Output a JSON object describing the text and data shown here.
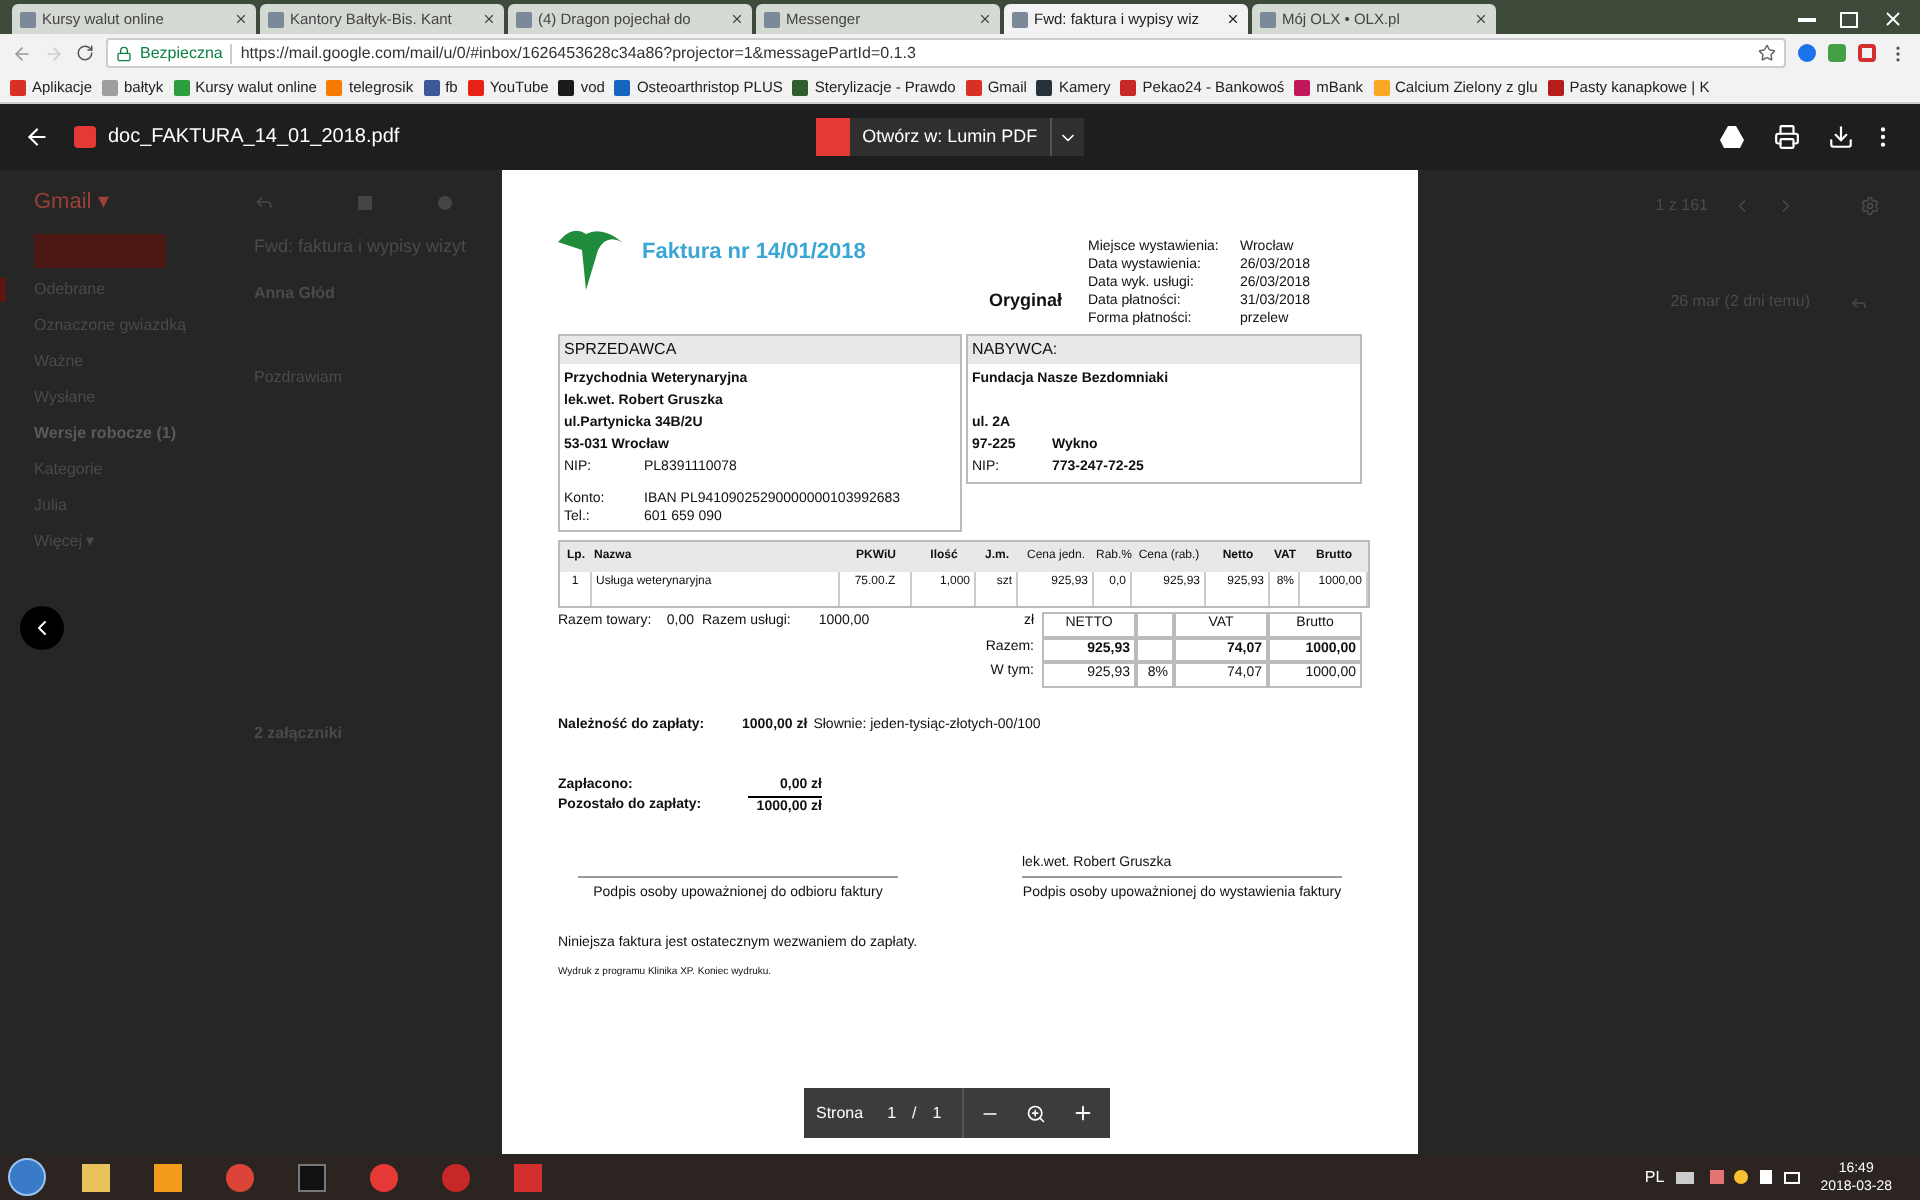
{
  "browser": {
    "tabs": [
      {
        "title": "Kursy walut online",
        "selected": false
      },
      {
        "title": "Kantory Bałtyk-Bis. Kant",
        "selected": false
      },
      {
        "title": "(4) Dragon pojechał do",
        "selected": false
      },
      {
        "title": "Messenger",
        "selected": false
      },
      {
        "title": "Fwd: faktura i wypisy wiz",
        "selected": true
      },
      {
        "title": "Mój OLX • OLX.pl",
        "selected": false
      }
    ],
    "address": {
      "secure_label": "Bezpieczna",
      "url": "https://mail.google.com/mail/u/0/#inbox/1626453628c34a86?projector=1&messagePartId=0.1.3"
    },
    "bookmarks": [
      {
        "label": "Aplikacje",
        "color": "#d93025"
      },
      {
        "label": "bałtyk",
        "color": "#9e9e9e"
      },
      {
        "label": "Kursy walut online",
        "color": "#2e9e3e"
      },
      {
        "label": "telegrosik",
        "color": "#f57c00"
      },
      {
        "label": "fb",
        "color": "#3b5998"
      },
      {
        "label": "YouTube",
        "color": "#e62117"
      },
      {
        "label": "vod",
        "color": "#1b1b1b"
      },
      {
        "label": "Osteoarthristop PLUS",
        "color": "#1565c0"
      },
      {
        "label": "Sterylizacje - Prawdo",
        "color": "#2e5d2e"
      },
      {
        "label": "Gmail",
        "color": "#d93025"
      },
      {
        "label": "Kamery",
        "color": "#263238"
      },
      {
        "label": "Pekao24 - Bankowoś",
        "color": "#c62828"
      },
      {
        "label": "mBank",
        "color": "#c2185b"
      },
      {
        "label": "Calcium Zielony z glu",
        "color": "#f9a825"
      },
      {
        "label": "Pasty kanapkowe | K",
        "color": "#b71c1c"
      }
    ]
  },
  "viewer": {
    "filename": "doc_FAKTURA_14_01_2018.pdf",
    "open_with": "Otwórz w: Lumin PDF"
  },
  "gmail": {
    "logo": "Gmail ▾",
    "nav": [
      {
        "label": "Odebrane",
        "selected": true
      },
      {
        "label": "Oznaczone gwiazdką",
        "selected": false
      },
      {
        "label": "Ważne",
        "selected": false
      },
      {
        "label": "Wysłane",
        "selected": false
      },
      {
        "label": "Wersje robocze (1)",
        "selected": false
      },
      {
        "label": "Kategorie",
        "selected": false
      },
      {
        "label": "Julia",
        "selected": false
      },
      {
        "label": "Więcej ▾",
        "selected": false
      }
    ],
    "subject": "Fwd: faktura i wypisy wizyt",
    "sender": "Anna Głód",
    "greeting": "Pozdrawiam",
    "attachments": "2 załączniki",
    "counter": "1 z 161",
    "date": "26 mar (2 dni temu)"
  },
  "invoice": {
    "title": "Faktura nr 14/01/2018",
    "copy": "Oryginał",
    "meta": [
      [
        "Miejsce wystawienia:",
        "Wrocław"
      ],
      [
        "Data wystawienia:",
        "26/03/2018"
      ],
      [
        "Data wyk. usługi:",
        "26/03/2018"
      ],
      [
        "Data płatności:",
        "31/03/2018"
      ],
      [
        "Forma płatności:",
        "przelew"
      ]
    ],
    "seller": {
      "header": "SPRZEDAWCA",
      "lines": [
        "Przychodnia Weterynaryjna",
        "lek.wet. Robert Gruszka",
        "ul.Partynicka 34B/2U",
        "53-031 Wrocław"
      ],
      "fields": [
        [
          "NIP:",
          "PL8391110078"
        ],
        [
          "Konto:",
          "IBAN PL94109025290000000103992683"
        ],
        [
          "Tel.:",
          "601 659 090"
        ]
      ]
    },
    "buyer": {
      "header": "NABYWCA:",
      "name": "Fundacja Nasze Bezdomniaki",
      "street": "ul. 2A",
      "postcode": "97-225",
      "city": "Wykno",
      "nip_label": "NIP:",
      "nip": "773-247-72-25"
    },
    "columns": [
      "Lp.",
      "Nazwa",
      "PKWiU",
      "Ilość",
      "J.m.",
      "Cena jedn.",
      "Rab.%",
      "Cena (rab.)",
      "Netto",
      "VAT",
      "Brutto"
    ],
    "rows": [
      [
        "1",
        "Usługa weterynaryjna",
        "75.00.Z",
        "1,000",
        "szt",
        "925,93",
        "0,0",
        "925,93",
        "925,93",
        "8%",
        "1000,00"
      ]
    ],
    "subtotals": [
      [
        "Razem towary:",
        "0,00"
      ],
      [
        "Razem usługi:",
        "1000,00"
      ]
    ],
    "currency": "zł",
    "summary_header": [
      "NETTO",
      "VAT",
      "Brutto"
    ],
    "summary_rows": [
      {
        "label": "Razem:",
        "cells": [
          "925,93",
          "",
          "74,07",
          "1000,00"
        ],
        "bold": true
      },
      {
        "label": "W tym:",
        "cells": [
          "925,93",
          "8%",
          "74,07",
          "1000,00"
        ],
        "bold": false
      }
    ],
    "due": {
      "label": "Należność do zapłaty:",
      "amount": "1000,00 zł",
      "words": "Słownie: jeden-tysiąc-złotych-00/100"
    },
    "paid": [
      [
        "Zapłacono:",
        "0,00 zł"
      ],
      [
        "Pozostało do zapłaty:",
        "1000,00 zł"
      ]
    ],
    "signatures": [
      {
        "caption": "Podpis osoby upoważnionej do odbioru faktury"
      },
      {
        "name": "lek.wet. Robert Gruszka",
        "caption": "Podpis osoby upoważnionej do wystawienia faktury"
      }
    ],
    "note": "Niniejsza faktura jest ostatecznym wezwaniem do zapłaty.",
    "footer": "Wydruk z programu Klinika XP. Koniec wydruku."
  },
  "page_controls": {
    "label": "Strona",
    "page": "1",
    "separator": "/",
    "total": "1"
  },
  "taskbar": {
    "language": "PL",
    "time": "16:49",
    "date": "2018-03-28"
  }
}
